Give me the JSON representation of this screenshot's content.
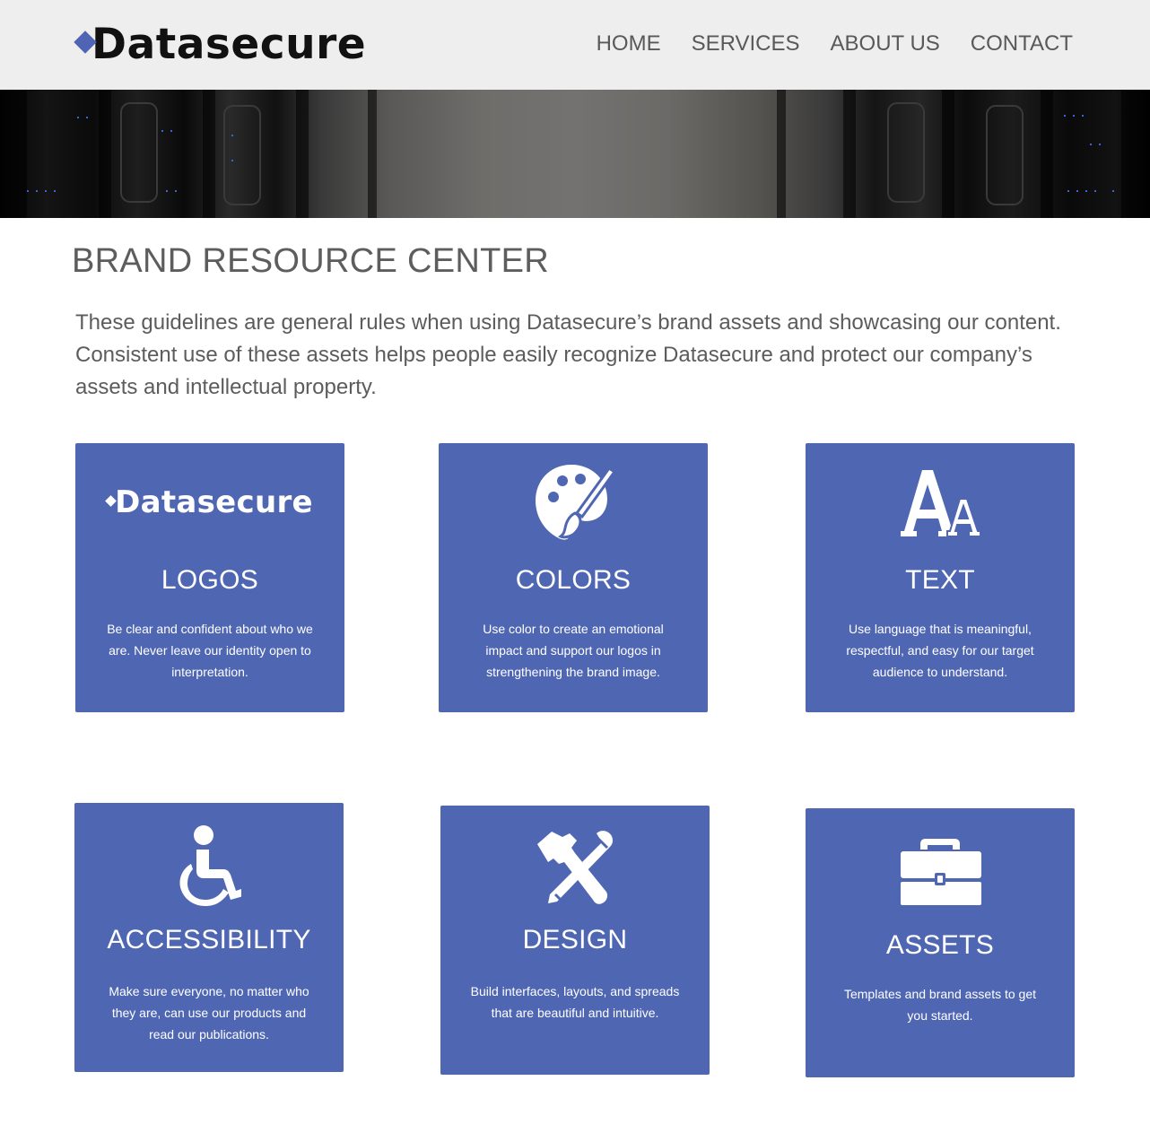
{
  "header": {
    "logo_text": "Datasecure",
    "nav": [
      "HOME",
      "SERVICES",
      "ABOUT US",
      "CONTACT"
    ]
  },
  "main": {
    "title": "BRAND RESOURCE CENTER",
    "intro": "These guidelines are general rules when using Datasecure’s brand assets and showcasing our content. Consistent use of these assets helps people easily recognize Datasecure and protect our company’s assets and intellectual property."
  },
  "cards": [
    {
      "icon": "datasecure-logo",
      "icon_text": "Datasecure",
      "title": "LOGOS",
      "desc": "Be clear and confident about who we are. Never leave our identity open to interpretation."
    },
    {
      "icon": "palette-icon",
      "title": "COLORS",
      "desc": "Use color to create an emotional impact and support our logos in strengthening the brand image."
    },
    {
      "icon": "text-size-icon",
      "title": "TEXT",
      "desc": "Use language that is meaningful, respectful, and easy for our target audience to understand."
    },
    {
      "icon": "wheelchair-icon",
      "title": "ACCESSIBILITY",
      "desc": "Make sure everyone, no matter who they are, can use our products and read our publications."
    },
    {
      "icon": "tools-icon",
      "title": "DESIGN",
      "desc": "Build interfaces, layouts, and spreads that are beautiful and intuitive."
    },
    {
      "icon": "briefcase-icon",
      "title": "ASSETS",
      "desc": "Templates and brand assets to get you started."
    }
  ],
  "colors": {
    "accent": "#4f66b3",
    "header_bg": "#eeeeee",
    "logo_mark": "#4f64b4"
  }
}
